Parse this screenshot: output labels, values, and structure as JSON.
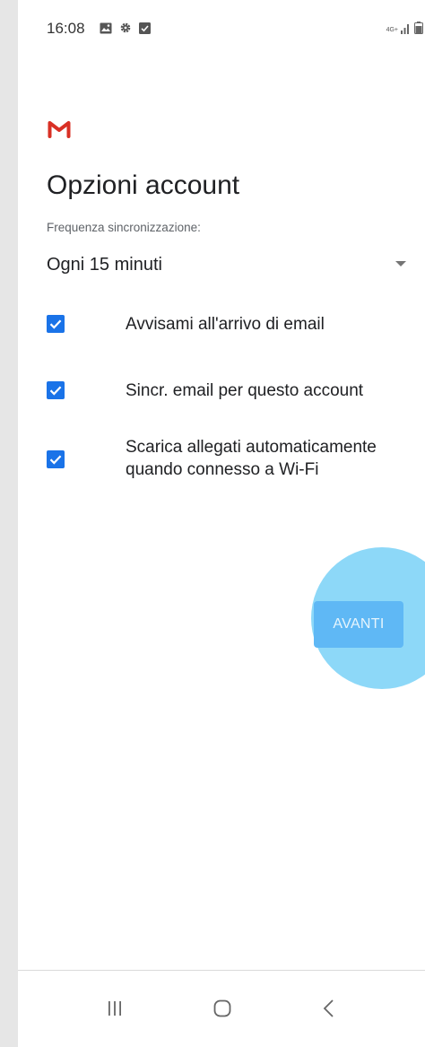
{
  "status_bar": {
    "time": "16:08",
    "network_label": "4G+",
    "left_icons": [
      "image-icon",
      "gear-icon",
      "checkbox-notification-icon"
    ],
    "right_icons": [
      "signal-icon",
      "battery-icon"
    ]
  },
  "header": {
    "logo": "gmail-logo-icon",
    "logo_color": "#d93025",
    "title": "Opzioni account"
  },
  "sync": {
    "label": "Frequenza sincronizzazione:",
    "selected_value": "Ogni 15 minuti"
  },
  "options": [
    {
      "lines": [
        "Avvisami all'arrivo di email"
      ],
      "checked": true
    },
    {
      "lines": [
        "Sincr. email per questo account"
      ],
      "checked": true
    },
    {
      "lines": [
        "Scarica allegati automaticamente",
        "quando connesso a Wi-Fi"
      ],
      "checked": true
    }
  ],
  "actions": {
    "next_label": "AVANTI",
    "next_color": "#5fb8f5",
    "ripple_color": "#81d4f7"
  },
  "nav_bar": {
    "buttons": [
      "recent-apps-icon",
      "home-icon",
      "back-icon"
    ]
  },
  "colors": {
    "accent": "#1a73e8",
    "text_primary": "#202124",
    "text_secondary": "#5f6368"
  }
}
